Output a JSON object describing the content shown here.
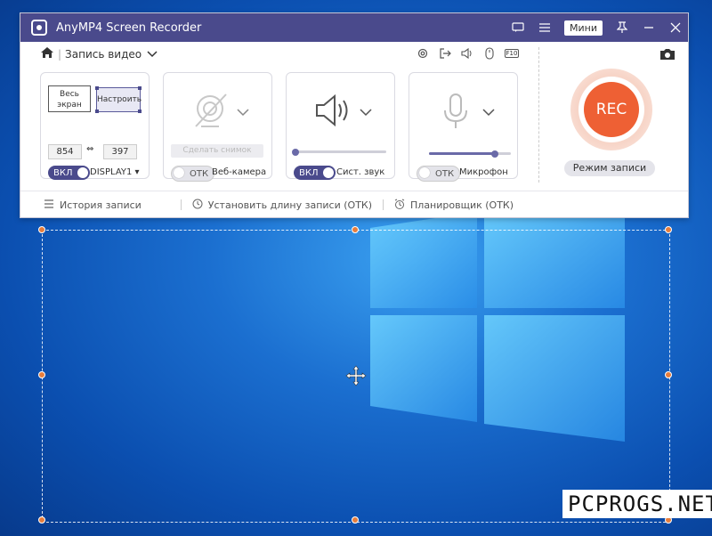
{
  "app": {
    "title": "AnyMP4 Screen Recorder",
    "mini_label": "Мини",
    "mode_title": "Запись видео"
  },
  "area": {
    "full_screen_label": "Весь экран",
    "custom_label": "Настроить",
    "width": "854",
    "height": "397",
    "toggle_label": "ВКЛ",
    "display_label": "DISPLAY1"
  },
  "webcam": {
    "snapshot_label": "Сделать снимок",
    "toggle_label": "ОТК",
    "label": "Веб-камера"
  },
  "system_sound": {
    "toggle_label": "ВКЛ",
    "label": "Сист. звук",
    "volume": 0.0
  },
  "microphone": {
    "toggle_label": "ОТК",
    "label": "Микрофон",
    "volume": 0.9
  },
  "rec": {
    "label": "REC",
    "mode_button": "Режим записи"
  },
  "footer": {
    "history": "История записи",
    "set_length": "Установить длину записи (ОТК)",
    "scheduler": "Планировщик (ОТК)"
  },
  "watermark": "PCPROGS.NET",
  "colors": {
    "titlebar": "#4a4a8c",
    "rec": "#ee6034",
    "handle": "#e67d3c"
  }
}
